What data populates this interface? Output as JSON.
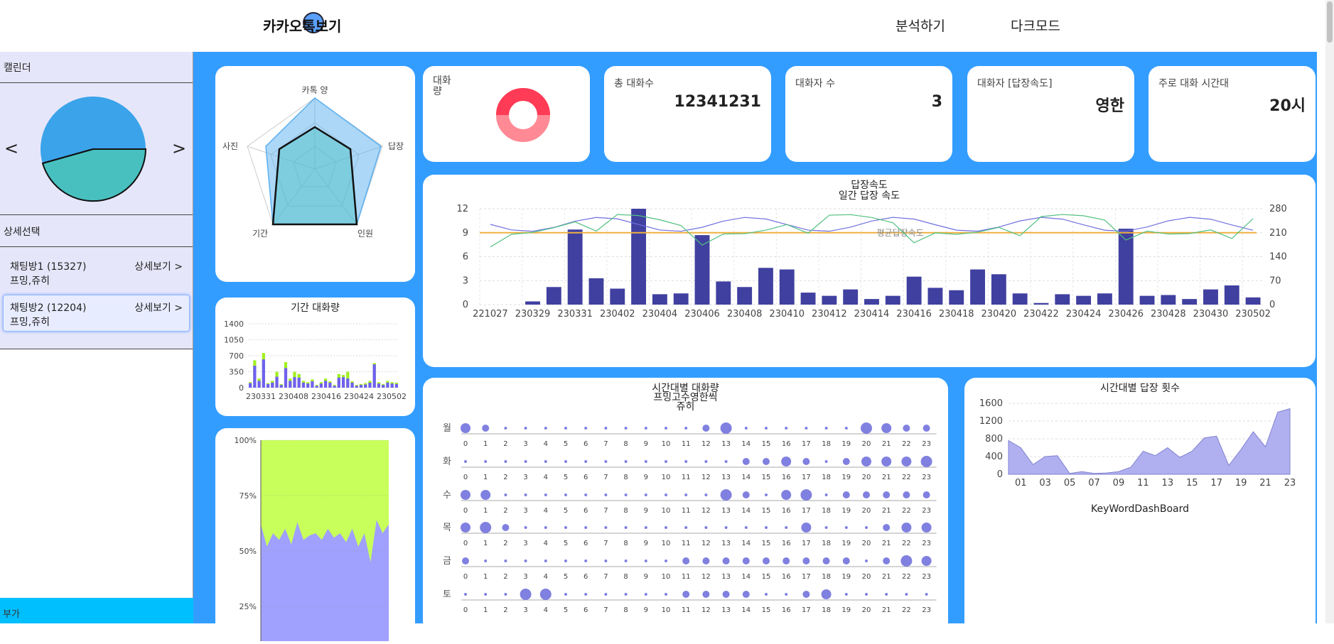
{
  "header": {
    "logo_text": "카카오톡보기",
    "nav": [
      "분석하기",
      "다크모드"
    ]
  },
  "sidebar": {
    "calendar_title": "캘린더",
    "prev": "<",
    "next": ">",
    "detail_title": "상세선택",
    "rooms": [
      {
        "name": "채팅방1 (15327)",
        "members": "프밍,쥬히",
        "more": "상세보기 >"
      },
      {
        "name": "채팅방2 (12204)",
        "members": "프밍,쥬히",
        "more": "상세보기 >"
      }
    ],
    "footer": "부가"
  },
  "radar": {
    "axes": [
      "카톡 양",
      "답장",
      "인원",
      "기간",
      "사진"
    ]
  },
  "stats": [
    {
      "label": "대화\n량",
      "value": ""
    },
    {
      "label": "총 대화수",
      "value": "12341231"
    },
    {
      "label": "대화자 수",
      "value": "3"
    },
    {
      "label": "대화자 [답장속도]",
      "value": "영한"
    },
    {
      "label": "주로 대화 시간대",
      "value": "20시"
    }
  ],
  "colors": {
    "primary": "#339dff",
    "bar": "#4040a0",
    "lavender": "#e6e6fa",
    "green": "#c8ff5a",
    "purple": "#9999ee",
    "red": "#ff4455"
  },
  "reply_chart": {
    "title": "답장속도",
    "subtitle": "일간 답장 속도",
    "avg_label": "평균답장속도",
    "x_labels": [
      "221027",
      "230329",
      "230331",
      "230402",
      "230404",
      "230406",
      "230408",
      "230410",
      "230412",
      "230414",
      "230416",
      "230418",
      "230420",
      "230422",
      "230424",
      "230426",
      "230428",
      "230430",
      "230502"
    ],
    "left_ticks": [
      "0",
      "3",
      "6",
      "9",
      "12"
    ],
    "right_ticks": [
      "0",
      "70",
      "140",
      "210",
      "280"
    ]
  },
  "period_chart": {
    "title": "기간 대화량",
    "y_ticks": [
      "0",
      "350",
      "700",
      "1050",
      "1400"
    ],
    "x_labels": [
      "230331",
      "230408",
      "230416",
      "230424",
      "230502"
    ]
  },
  "area_chart": {
    "y_ticks": [
      "100%",
      "75%",
      "50%",
      "25%"
    ]
  },
  "heatmap": {
    "title": "시간대별 대화량",
    "subtitle": "프밍고수영한씩",
    "subtitle2": "쥬히",
    "days": [
      "월",
      "화",
      "수",
      "목",
      "금",
      "토"
    ],
    "hours": [
      "0",
      "1",
      "2",
      "3",
      "4",
      "5",
      "6",
      "7",
      "8",
      "9",
      "10",
      "11",
      "12",
      "13",
      "14",
      "15",
      "16",
      "17",
      "18",
      "19",
      "20",
      "21",
      "22",
      "23"
    ]
  },
  "hourly_chart": {
    "title": "시간대별 답장 횟수",
    "y_ticks": [
      "0",
      "400",
      "800",
      "1200",
      "1600"
    ],
    "x_labels": [
      "01",
      "03",
      "05",
      "07",
      "09",
      "11",
      "13",
      "15",
      "17",
      "19",
      "21",
      "23"
    ]
  },
  "keyword": {
    "title": "KeyWordDashBoard"
  },
  "chart_data": [
    {
      "type": "bar",
      "title": "답장속도",
      "subtitle": "일간 답장 속도",
      "ylim": [
        0,
        12
      ],
      "y2lim": [
        0,
        280
      ],
      "values": [
        0,
        0,
        0.4,
        2.2,
        9.4,
        3.3,
        2,
        12,
        1.3,
        1.4,
        8.7,
        2.9,
        2.2,
        4.6,
        4.4,
        1.5,
        1.1,
        1.9,
        0.7,
        1.1,
        3.5,
        2.1,
        1.8,
        4.4,
        3.8,
        1.4,
        0.2,
        1.3,
        1.1,
        1.4,
        9.5,
        1.1,
        1.2,
        0.7,
        1.9,
        2.4,
        0.9
      ],
      "series": [
        {
          "name": "avg",
          "values": [
            210,
            210,
            210,
            210,
            210,
            210,
            210,
            210,
            210,
            210,
            210,
            210,
            210,
            210,
            210,
            210,
            210,
            210,
            210,
            210,
            210,
            210,
            210,
            210,
            210,
            210,
            210,
            210,
            210,
            210,
            210,
            210,
            210,
            210,
            210,
            210,
            210
          ]
        }
      ]
    },
    {
      "type": "bar",
      "title": "기간 대화량",
      "ylim": [
        0,
        1400
      ],
      "series": [
        {
          "name": "a",
          "values": [
            120,
            600,
            200,
            760,
            100,
            150,
            350,
            80,
            560,
            200,
            350,
            300,
            150,
            120,
            180,
            60,
            120,
            200,
            140,
            60,
            300,
            280,
            350,
            140,
            60,
            80,
            100,
            150,
            540,
            120,
            80,
            150,
            120,
            110
          ]
        },
        {
          "name": "b",
          "values": [
            100,
            480,
            150,
            620,
            80,
            110,
            240,
            60,
            430,
            150,
            230,
            220,
            110,
            90,
            140,
            40,
            90,
            150,
            110,
            40,
            220,
            230,
            200,
            110,
            40,
            60,
            70,
            110,
            510,
            90,
            60,
            110,
            90,
            80
          ]
        }
      ]
    },
    {
      "type": "area",
      "series": [
        {
          "name": "bottom",
          "values": [
            0.62,
            0.52,
            0.58,
            0.55,
            0.6,
            0.53,
            0.63,
            0.55,
            0.57,
            0.58,
            0.55,
            0.6,
            0.56,
            0.58,
            0.54,
            0.6,
            0.52,
            0.58,
            0.45,
            0.64,
            0.58,
            0.62
          ]
        }
      ]
    },
    {
      "type": "area",
      "title": "시간대별 답장 횟수",
      "ylim": [
        0,
        1600
      ],
      "x": [
        "00",
        "01",
        "02",
        "03",
        "04",
        "05",
        "06",
        "07",
        "08",
        "09",
        "10",
        "11",
        "12",
        "13",
        "14",
        "15",
        "16",
        "17",
        "18",
        "19",
        "20",
        "21",
        "22",
        "23"
      ],
      "values": [
        760,
        600,
        220,
        400,
        420,
        20,
        60,
        20,
        30,
        60,
        160,
        520,
        420,
        600,
        380,
        520,
        820,
        860,
        200,
        560,
        960,
        620,
        1400,
        1480
      ]
    },
    {
      "type": "scatter",
      "title": "시간대별 대화량",
      "values": [
        [
          3,
          2,
          1,
          1,
          1,
          1,
          1,
          1,
          1,
          1,
          1,
          1,
          2,
          4,
          1,
          1,
          1,
          1,
          1,
          1,
          4,
          3,
          2,
          2
        ],
        [
          1,
          1,
          1,
          1,
          1,
          1,
          1,
          1,
          1,
          1,
          1,
          1,
          1,
          1,
          2,
          2,
          3,
          2,
          1,
          2,
          3,
          3,
          3,
          4
        ],
        [
          3,
          3,
          1,
          1,
          1,
          1,
          1,
          1,
          1,
          1,
          1,
          1,
          1,
          4,
          2,
          1,
          3,
          4,
          1,
          2,
          2,
          2,
          2,
          2
        ],
        [
          3,
          4,
          2,
          1,
          1,
          1,
          1,
          1,
          1,
          1,
          1,
          1,
          1,
          1,
          1,
          1,
          1,
          3,
          1,
          1,
          1,
          2,
          3,
          3
        ],
        [
          2,
          1,
          1,
          1,
          1,
          1,
          1,
          1,
          1,
          1,
          1,
          2,
          2,
          2,
          2,
          2,
          2,
          2,
          2,
          2,
          1,
          2,
          4,
          3
        ],
        [
          1,
          1,
          1,
          4,
          4,
          1,
          1,
          1,
          1,
          1,
          1,
          2,
          2,
          2,
          2,
          1,
          1,
          2,
          3,
          1,
          1,
          1,
          1,
          1
        ]
      ]
    }
  ]
}
